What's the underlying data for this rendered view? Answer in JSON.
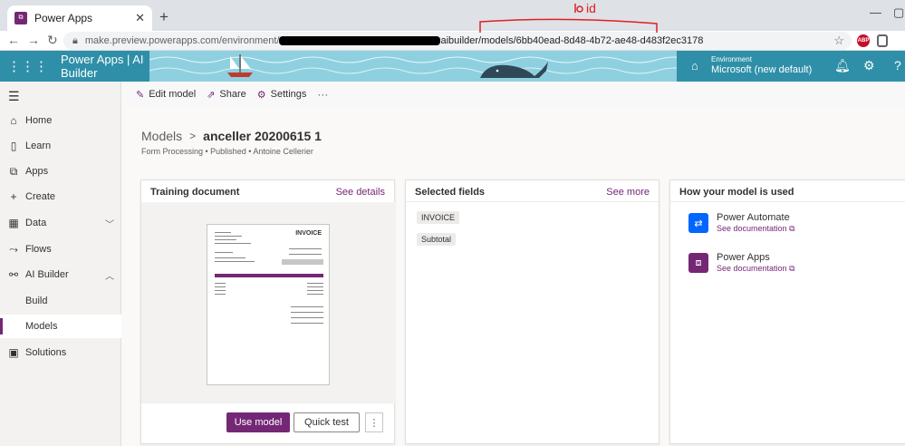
{
  "browser": {
    "tab_title": "Power Apps",
    "new_tab": "+",
    "close": "✕",
    "url_prefix": "make.preview.powerapps.com/environment/",
    "url_suffix": "aibuilder/models/6bb40ead-8d48-4b72-ae48-d483f2ec3178",
    "annotation_text": "id"
  },
  "header": {
    "app_title": "Power Apps  |  AI Builder",
    "environment_label": "Environment",
    "environment_name": "Microsoft (new default)"
  },
  "sidebar": {
    "items": [
      {
        "label": "Home",
        "icon": "home-icon"
      },
      {
        "label": "Learn",
        "icon": "book-icon"
      },
      {
        "label": "Apps",
        "icon": "apps-icon"
      },
      {
        "label": "Create",
        "icon": "plus-icon"
      },
      {
        "label": "Data",
        "icon": "table-icon"
      },
      {
        "label": "Flows",
        "icon": "flow-icon"
      },
      {
        "label": "AI Builder",
        "icon": "ai-builder-icon"
      },
      {
        "label": "Build"
      },
      {
        "label": "Models"
      },
      {
        "label": "Solutions",
        "icon": "solutions-icon"
      }
    ]
  },
  "commandbar": {
    "edit_model": "Edit model",
    "share": "Share",
    "settings": "Settings",
    "more": "···"
  },
  "main": {
    "breadcrumb_root": "Models",
    "breadcrumb_current": "anceller 20200615 1",
    "subinfo": "Form Processing • Published • Antoine Cellerier",
    "training": {
      "title": "Training document",
      "link": "See details",
      "invoice_title": "INVOICE",
      "use_model": "Use model",
      "quick_test": "Quick test",
      "more": "⋮"
    },
    "fields": {
      "title": "Selected fields",
      "link": "See more",
      "items": [
        "INVOICE",
        "Subtotal"
      ]
    },
    "usage": {
      "title": "How your model is used",
      "items": [
        {
          "name": "Power Automate",
          "link": "See documentation",
          "color": "#0066ff"
        },
        {
          "name": "Power Apps",
          "link": "See documentation",
          "color": "#742774"
        }
      ]
    }
  },
  "colors": {
    "accent": "#742774",
    "header_bg": "#2f8fa8"
  }
}
